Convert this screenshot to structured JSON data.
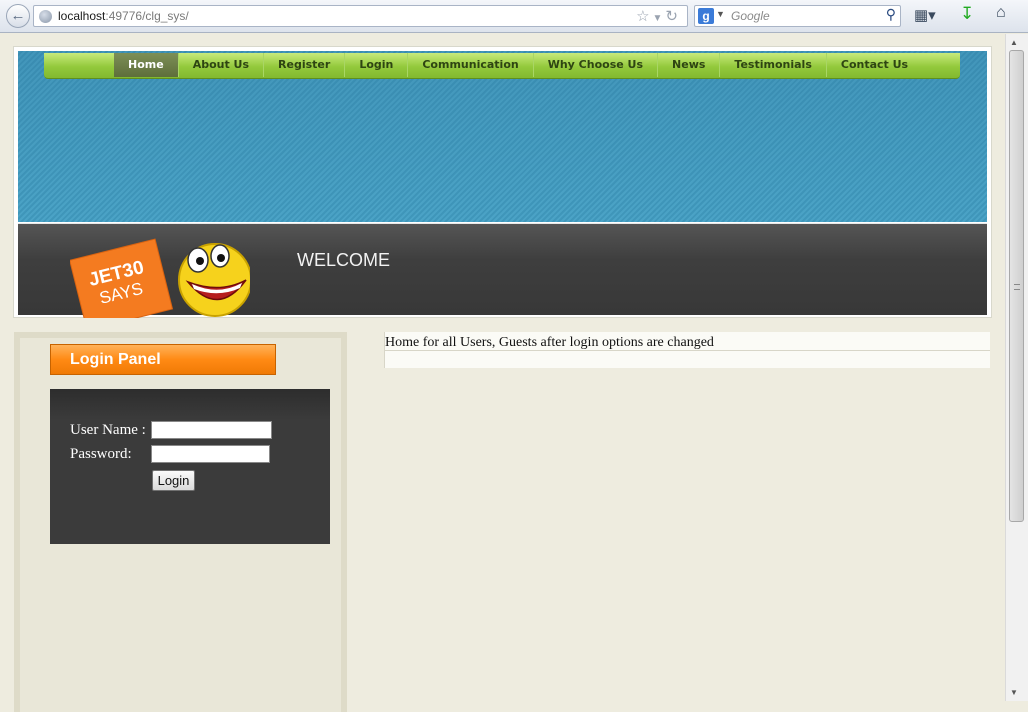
{
  "browser": {
    "url_host": "localhost",
    "url_rest": ":49776/clg_sys/",
    "search_placeholder": "Google",
    "search_engine_letter": "g"
  },
  "nav": {
    "items": [
      {
        "label": "Home",
        "active": true
      },
      {
        "label": "About Us"
      },
      {
        "label": "Register"
      },
      {
        "label": "Login"
      },
      {
        "label": "Communication"
      },
      {
        "label": "Why Choose Us"
      },
      {
        "label": "News"
      },
      {
        "label": "Testimonials"
      },
      {
        "label": "Contact Us"
      }
    ]
  },
  "logo": {
    "line1": "JET30",
    "line2": "SAYS"
  },
  "banner": {
    "welcome": "WELCOME"
  },
  "login_panel": {
    "title": "Login Panel",
    "username_label": "User Name :",
    "password_label": "Password:",
    "username_value": "",
    "password_value": "",
    "button_label": "Login"
  },
  "content": {
    "message": "Home for all Users, Guests after login options are changed"
  },
  "colors": {
    "nav_green": "#93c93c",
    "banner_blue": "#4ba3c6",
    "login_orange": "#ff8a14",
    "dark_panel": "#3b3b3b",
    "page_bg": "#eeecdf"
  }
}
